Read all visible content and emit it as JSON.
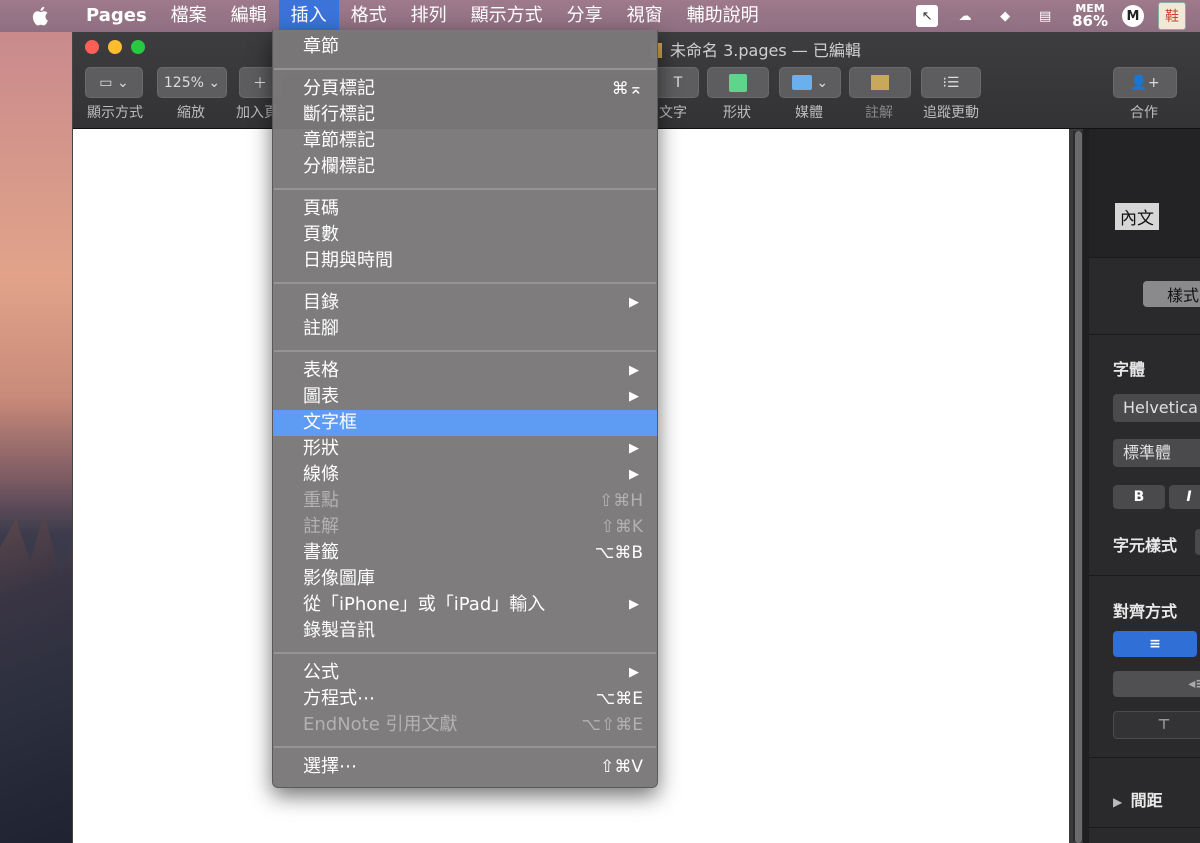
{
  "menubar": {
    "app": "Pages",
    "items": [
      "檔案",
      "編輯",
      "插入",
      "格式",
      "排列",
      "顯示方式",
      "分享",
      "視窗",
      "輔助說明"
    ],
    "active_index": 2,
    "status": {
      "mem_label": "MEM",
      "mem_value": "86%",
      "m_badge": "M",
      "avatar_text": "鞋"
    }
  },
  "window": {
    "title": "未命名 3.pages — 已編輯",
    "toolbar": {
      "view_label": "顯示方式",
      "zoom_value": "125%",
      "zoom_label": "縮放",
      "add_label": "加入頁",
      "text_label": "文字",
      "shape_label": "形狀",
      "media_label": "媒體",
      "comment_label": "註解",
      "track_label": "追蹤更動",
      "collab_label": "合作"
    }
  },
  "sidebar": {
    "para_style": "內文",
    "tab_style": "樣式",
    "font_heading": "字體",
    "font_family": "Helvetica",
    "font_weight": "標準體",
    "bold": "B",
    "italic": "I",
    "char_style_heading": "字元樣式",
    "align_heading": "對齊方式",
    "spacing_heading": "間距"
  },
  "menu": {
    "items": [
      {
        "label": "章節"
      },
      {
        "sep": true
      },
      {
        "label": "分頁標記",
        "shortcut": "⌘⌅"
      },
      {
        "label": "斷行標記"
      },
      {
        "label": "章節標記"
      },
      {
        "label": "分欄標記"
      },
      {
        "sep": true
      },
      {
        "label": "頁碼"
      },
      {
        "label": "頁數"
      },
      {
        "label": "日期與時間"
      },
      {
        "sep": true
      },
      {
        "label": "目錄",
        "submenu": true
      },
      {
        "label": "註腳"
      },
      {
        "sep": true
      },
      {
        "label": "表格",
        "submenu": true
      },
      {
        "label": "圖表",
        "submenu": true
      },
      {
        "label": "文字框",
        "highlighted": true
      },
      {
        "label": "形狀",
        "submenu": true
      },
      {
        "label": "線條",
        "submenu": true
      },
      {
        "label": "重點",
        "shortcut": "⇧⌘H",
        "disabled": true
      },
      {
        "label": "註解",
        "shortcut": "⇧⌘K",
        "disabled": true
      },
      {
        "label": "書籤",
        "shortcut": "⌥⌘B"
      },
      {
        "label": "影像圖庫"
      },
      {
        "label": "從「iPhone」或「iPad」輸入",
        "submenu": true
      },
      {
        "label": "錄製音訊"
      },
      {
        "sep": true
      },
      {
        "label": "公式",
        "submenu": true
      },
      {
        "label": "方程式⋯",
        "shortcut": "⌥⌘E"
      },
      {
        "label": "EndNote 引用文獻",
        "shortcut": "⌥⇧⌘E",
        "disabled": true
      },
      {
        "sep": true
      },
      {
        "label": "選擇⋯",
        "shortcut": "⇧⌘V"
      }
    ]
  }
}
